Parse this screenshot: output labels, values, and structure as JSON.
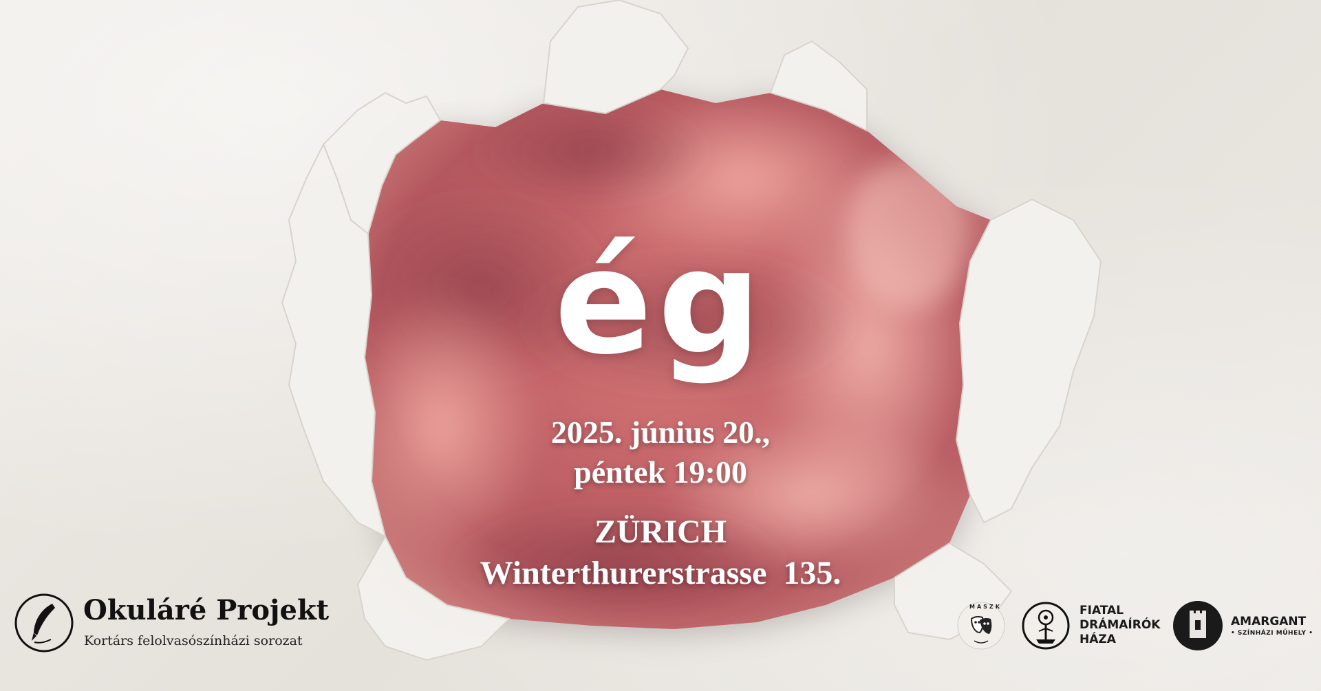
{
  "event": {
    "title": "ég",
    "date_line1": "2025. június 20.,",
    "date_line2": "péntek 19:00",
    "city": "ZÜRICH",
    "address": "Winterthurerstrasse  135."
  },
  "organizer": {
    "name": "Okuláré Projekt",
    "subtitle": "Kortárs felolvasószínházi sorozat",
    "logo_icon": "quill-pen-icon"
  },
  "partners": [
    {
      "id": "maszk",
      "logo_icon": "theater-masks-icon",
      "label": "MASZK"
    },
    {
      "id": "fiatal",
      "logo_icon": "tree-icon",
      "label_lines": [
        "FIATAL",
        "DRÁMAÍRÓK",
        "HÁZA"
      ]
    },
    {
      "id": "amargant",
      "logo_icon": "tower-icon",
      "label": "AMARGANT",
      "sublabel": "• SZÍNHÁZI MŰHELY •"
    }
  ],
  "colors": {
    "sky_main": "#c9686a",
    "sky_light": "#e89a92",
    "sky_dark": "#9a4a52",
    "paper": "#e9e6e1",
    "text_light": "#ffffff",
    "text_dark": "#111111"
  }
}
